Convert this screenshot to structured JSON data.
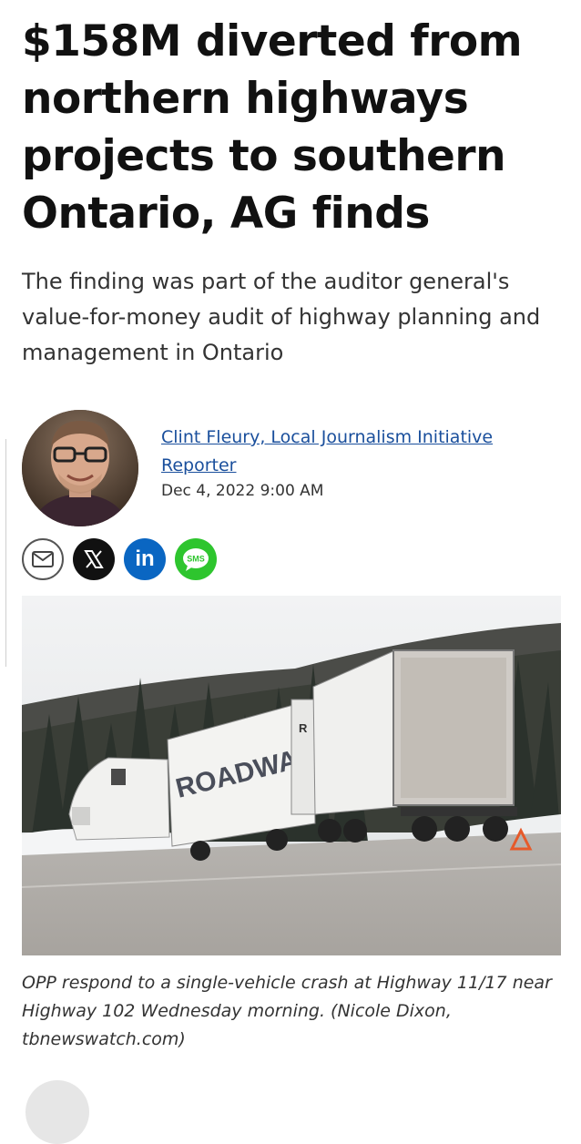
{
  "article": {
    "headline": "$158M diverted from northern highways projects to southern Ontario, AG finds",
    "subhead": "The finding was part of the auditor general's value-for-money audit of highway planning and management in Ontario",
    "author": "Clint Fleury, Local Journalism Initiative Reporter",
    "date": "Dec 4, 2022 9:00 AM",
    "caption": "OPP respond to a single-vehicle crash at Highway 11/17 near Highway 102 Wednesday morning. (Nicole Dixon, tbnewswatch.com)"
  },
  "share": {
    "sms_label": "SMS",
    "linkedin_label": "in",
    "icons": [
      "email-icon",
      "x-icon",
      "linkedin-icon",
      "sms-icon"
    ]
  },
  "photo": {
    "truck_text": "ROADWAY",
    "trailer_letter": "R"
  },
  "colors": {
    "link": "#1a4f9c",
    "linkedin": "#0a66c2",
    "sms": "#2ec52e",
    "x": "#111111"
  }
}
